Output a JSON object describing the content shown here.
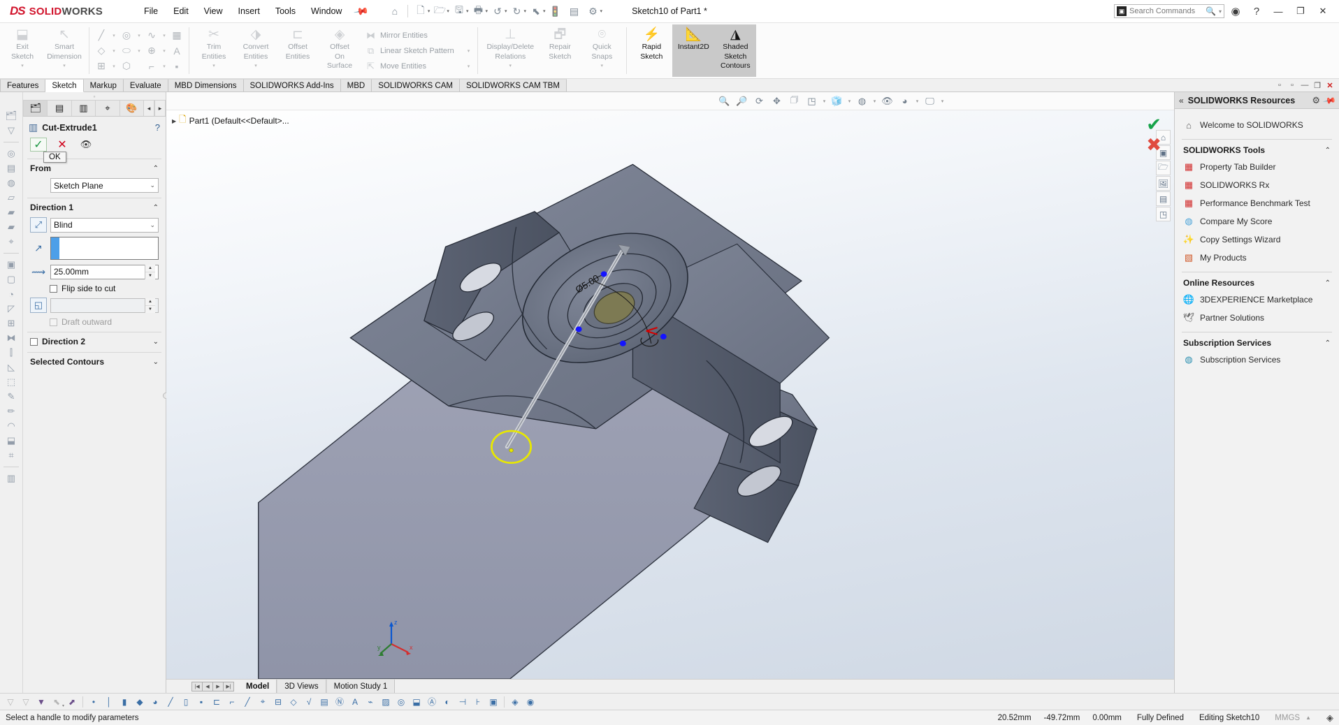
{
  "app": {
    "brand_ds": "DS",
    "brand_solid": "SOLID",
    "brand_works": "WORKS",
    "document_title": "Sketch10 of Part1 *"
  },
  "menubar": {
    "items": [
      {
        "label": "File"
      },
      {
        "label": "Edit"
      },
      {
        "label": "View"
      },
      {
        "label": "Insert"
      },
      {
        "label": "Tools"
      },
      {
        "label": "Window"
      }
    ],
    "pin_icon": "pin-icon"
  },
  "quick_access": {
    "icons": [
      "home-icon",
      "new-document-icon",
      "open-folder-icon",
      "save-icon",
      "print-icon",
      "undo-icon",
      "redo-icon",
      "select-icon",
      "rebuild-icon",
      "file-properties-icon",
      "options-gear-icon"
    ]
  },
  "search": {
    "placeholder": "Search Commands",
    "icon": "search-icon",
    "prefix_icon": "command-prompt-icon",
    "caret": "chevron-down-icon"
  },
  "titlebar_right": {
    "account_icon": "account-circle-icon",
    "help_icon": "help-circle-icon",
    "minimize": "minimize-icon",
    "restore": "restore-icon",
    "close": "close-icon"
  },
  "ribbon": {
    "groups": [
      {
        "name": "sketch-main",
        "buttons": [
          {
            "label_line1": "Exit",
            "label_line2": "Sketch",
            "icon": "exit-sketch-icon",
            "state": "normal",
            "has_caret": true
          },
          {
            "label_line1": "Smart",
            "label_line2": "Dimension",
            "icon": "smart-dimension-icon",
            "state": "normal",
            "has_caret": true
          }
        ]
      },
      {
        "name": "sketch-entities",
        "tools": [
          "line-icon",
          "circle-icon",
          "spline-icon",
          "grid-icon",
          "rectangle-icon",
          "slot-icon",
          "ellipse-icon",
          "text-icon",
          "linear-pattern-icon",
          "polygon-icon",
          "fillet-icon",
          "point-icon"
        ]
      },
      {
        "name": "modify-entities",
        "buttons": [
          {
            "label_line1": "Trim",
            "label_line2": "Entities",
            "icon": "trim-entities-icon",
            "state": "normal",
            "has_caret": true
          },
          {
            "label_line1": "Convert",
            "label_line2": "Entities",
            "icon": "convert-entities-icon",
            "state": "normal",
            "has_caret": true
          },
          {
            "label_line1": "Offset",
            "label_line2": "Entities",
            "icon": "offset-entities-icon",
            "state": "normal",
            "has_caret": false
          },
          {
            "label_line1": "Offset",
            "label_line2": "On",
            "label_line3": "Surface",
            "icon": "offset-on-surface-icon",
            "state": "normal",
            "has_caret": false
          }
        ],
        "small_items": [
          {
            "label": "Mirror Entities",
            "icon": "mirror-entities-icon",
            "has_caret": false
          },
          {
            "label": "Linear Sketch Pattern",
            "icon": "linear-sketch-pattern-icon",
            "has_caret": true
          },
          {
            "label": "Move Entities",
            "icon": "move-entities-icon",
            "has_caret": true
          }
        ]
      },
      {
        "name": "relations",
        "buttons": [
          {
            "label_line1": "Display/Delete",
            "label_line2": "Relations",
            "icon": "display-delete-relations-icon",
            "state": "normal",
            "has_caret": true
          },
          {
            "label_line1": "Repair",
            "label_line2": "Sketch",
            "icon": "repair-sketch-icon",
            "state": "normal",
            "has_caret": false
          },
          {
            "label_line1": "Quick",
            "label_line2": "Snaps",
            "icon": "quick-snaps-icon",
            "state": "normal",
            "has_caret": true
          }
        ]
      },
      {
        "name": "sketch-modes",
        "buttons": [
          {
            "label_line1": "Rapid",
            "label_line2": "Sketch",
            "icon": "rapid-sketch-icon",
            "state": "enabled",
            "has_caret": false
          },
          {
            "label_line1": "Instant2D",
            "label_line2": "",
            "icon": "instant-2d-icon",
            "state": "active",
            "has_caret": false
          },
          {
            "label_line1": "Shaded",
            "label_line2": "Sketch",
            "label_line3": "Contours",
            "icon": "shaded-sketch-contours-icon",
            "state": "active",
            "has_caret": false
          }
        ]
      }
    ]
  },
  "command_tabs": {
    "items": [
      {
        "label": "Features",
        "selected": false
      },
      {
        "label": "Sketch",
        "selected": true
      },
      {
        "label": "Markup",
        "selected": false
      },
      {
        "label": "Evaluate",
        "selected": false
      },
      {
        "label": "MBD Dimensions",
        "selected": false
      },
      {
        "label": "SOLIDWORKS Add-Ins",
        "selected": false
      },
      {
        "label": "MBD",
        "selected": false
      },
      {
        "label": "SOLIDWORKS CAM",
        "selected": false
      },
      {
        "label": "SOLIDWORKS CAM TBM",
        "selected": false
      }
    ],
    "window_controls": [
      "restore-down-icon",
      "restore-icon",
      "minimize-icon",
      "maximize-icon",
      "close-window-icon"
    ]
  },
  "left_rail": {
    "icons": [
      "feature-manager-icon",
      "property-manager-icon",
      "configuration-manager-icon",
      "dimxpert-icon",
      "display-manager-icon",
      "appearance-icon",
      "filter-icon",
      "sensor-icon",
      "annotation-icon",
      "material-icon",
      "plane-front-icon",
      "plane-top-icon",
      "plane-right-icon",
      "origin-icon",
      "boss-extrude-icon",
      "cut-extrude-icon",
      "fillet-icon",
      "chamfer-icon",
      "pattern-icon",
      "mirror-icon",
      "rib-icon",
      "draft-icon",
      "shell-icon",
      "sketch-icon",
      "three-d-sketch-icon",
      "surface-icon",
      "mold-icon",
      "weldment-icon"
    ]
  },
  "property_manager": {
    "tabs": [
      {
        "icon": "feature-manager-tree-icon",
        "selected": true
      },
      {
        "icon": "property-manager-icon",
        "selected": false
      },
      {
        "icon": "configuration-manager-icon",
        "selected": false
      },
      {
        "icon": "dimxpert-manager-icon",
        "selected": false
      },
      {
        "icon": "display-manager-icon",
        "selected": false
      }
    ],
    "tab_arrows": {
      "left": "chevron-left-icon",
      "right": "chevron-right-icon"
    },
    "header": {
      "icon": "cut-extrude-feature-icon",
      "title": "Cut-Extrude1",
      "help_icon": "help-circle-icon"
    },
    "actions": {
      "ok_icon": "checkmark-icon",
      "cancel_icon": "x-cancel-icon",
      "preview_icon": "eye-preview-icon",
      "tooltip": "OK"
    },
    "from": {
      "title": "From",
      "collapse_icon": "chevron-up-icon",
      "value": "Sketch Plane"
    },
    "direction1": {
      "title": "Direction 1",
      "collapse_icon": "chevron-up-icon",
      "reverse_icon": "reverse-direction-icon",
      "end_condition": "Blind",
      "direction_vector_icon": "direction-arrow-icon",
      "direction_vector_value": "",
      "depth_icon": "depth-d1-icon",
      "depth_value": "25.00mm",
      "flip_side_label": "Flip side to cut",
      "flip_side_checked": false,
      "draft_icon": "draft-angle-icon",
      "draft_value": "",
      "draft_outward_label": "Draft outward",
      "draft_outward_checked": false,
      "draft_outward_disabled": true
    },
    "direction2": {
      "title": "Direction 2",
      "checked": false,
      "collapse_icon": "chevron-down-icon"
    },
    "selected_contours": {
      "title": "Selected Contours",
      "collapse_icon": "chevron-down-icon"
    }
  },
  "viewport_toolbar": {
    "icons": [
      "zoom-fit-icon",
      "zoom-area-icon",
      "rotate-view-icon",
      "pan-icon",
      "three-d-drawing-view-icon",
      "view-orientation-icon",
      "display-style-icon",
      "hide-show-items-icon",
      "edit-appearance-icon",
      "apply-scene-icon",
      "view-settings-icon"
    ],
    "carets": [
      "chevron-down-icon"
    ]
  },
  "feature_tree_overlay": {
    "expander_icon": "triangle-right-icon",
    "part_icon": "part-document-icon",
    "label": "Part1  (Default<<Default>..."
  },
  "viewport_right_rail": {
    "icons": [
      "view-home-icon",
      "view-front-icon",
      "view-folder-icon",
      "view-display-icon",
      "view-annotations-icon",
      "view-section-icon"
    ]
  },
  "confirm_corner": {
    "ok_icon": "green-check-icon",
    "cancel_icon": "red-x-icon"
  },
  "model": {
    "dimension_label": "Ø5.00",
    "triad": {
      "x": "x",
      "y": "y",
      "z": "z"
    },
    "colors": {
      "body_light": "#9a9db0",
      "body_mid": "#6e7585",
      "body_dark": "#4c525f",
      "selection_yellow": "#e8e800",
      "sketch_blue": "#1414ff",
      "sketch_red": "#d40000",
      "handle_gray": "#b9b9b9"
    }
  },
  "bottom_tabs": {
    "nav_icons": [
      "first-icon",
      "prev-icon",
      "next-icon",
      "last-icon"
    ],
    "items": [
      {
        "label": "Model",
        "selected": true
      },
      {
        "label": "3D Views",
        "selected": false
      },
      {
        "label": "Motion Study 1",
        "selected": false
      }
    ]
  },
  "bottom_toolbar": {
    "icons": [
      "filter-all-icon",
      "filter-none-icon",
      "filter-active-icon",
      "select-arrow-icon",
      "select-other-icon",
      "point-relation-icon",
      "line-relation-icon",
      "surface-relation-icon",
      "face-relation-icon",
      "body-relation-icon",
      "midpoint-relation-icon",
      "axis-relation-icon",
      "vertex-relation-icon",
      "edge-relation-icon",
      "silhouette-relation-icon",
      "tangent-relation-icon",
      "center-mark-icon",
      "dimension-relation-icon",
      "datum-relation-icon",
      "weld-relation-icon",
      "note-relation-icon",
      "annotation-relation-icon",
      "text-relation-icon",
      "sketch-relation-icon",
      "hatch-relation-icon",
      "balloon-relation-icon",
      "block-relation-icon",
      "reference-relation-icon",
      "hole-relation-icon",
      "component-relation-icon",
      "magnify-relation-icon",
      "mate-relation-icon",
      "connection-relation-icon"
    ]
  },
  "statusbar": {
    "message": "Select a handle to modify parameters",
    "coord_x": "20.52mm",
    "coord_y": "-49.72mm",
    "coord_z": "0.00mm",
    "sketch_status": "Fully Defined",
    "edit_state": "Editing Sketch10",
    "units": "MMGS",
    "units_caret": "chevron-up-icon",
    "logo_icon": "solidworks-logo-icon"
  },
  "task_pane": {
    "header": {
      "collapse_icon": "chevrons-left-icon",
      "title": "SOLIDWORKS Resources",
      "gear_icon": "gear-icon",
      "pin_icon": "pin-icon"
    },
    "welcome": {
      "label": "Welcome to SOLIDWORKS",
      "icon": "home-icon"
    },
    "groups": [
      {
        "title": "SOLIDWORKS Tools",
        "collapse_icon": "chevron-up-icon",
        "items": [
          {
            "label": "Property Tab Builder",
            "icon": "property-tab-builder-icon",
            "color": "#d12b2b"
          },
          {
            "label": "SOLIDWORKS Rx",
            "icon": "solidworks-rx-icon",
            "color": "#d12b2b"
          },
          {
            "label": "Performance Benchmark Test",
            "icon": "performance-benchmark-icon",
            "color": "#d12b2b"
          },
          {
            "label": "Compare My Score",
            "icon": "compare-my-score-icon",
            "color": "#4aa3d8"
          },
          {
            "label": "Copy Settings Wizard",
            "icon": "copy-settings-wizard-icon",
            "color": "#c0392b"
          },
          {
            "label": "My Products",
            "icon": "my-products-icon",
            "color": "#d05a2b"
          }
        ]
      },
      {
        "title": "Online Resources",
        "collapse_icon": "chevron-up-icon",
        "items": [
          {
            "label": "3DEXPERIENCE Marketplace",
            "icon": "marketplace-globe-icon",
            "color": "#2b6fb0"
          },
          {
            "label": "Partner Solutions",
            "icon": "partner-solutions-icon",
            "color": "#6a6a6a"
          }
        ]
      },
      {
        "title": "Subscription Services",
        "collapse_icon": "chevron-up-icon",
        "items": [
          {
            "label": "Subscription Services",
            "icon": "subscription-services-icon",
            "color": "#2b8fb0"
          }
        ]
      }
    ]
  }
}
